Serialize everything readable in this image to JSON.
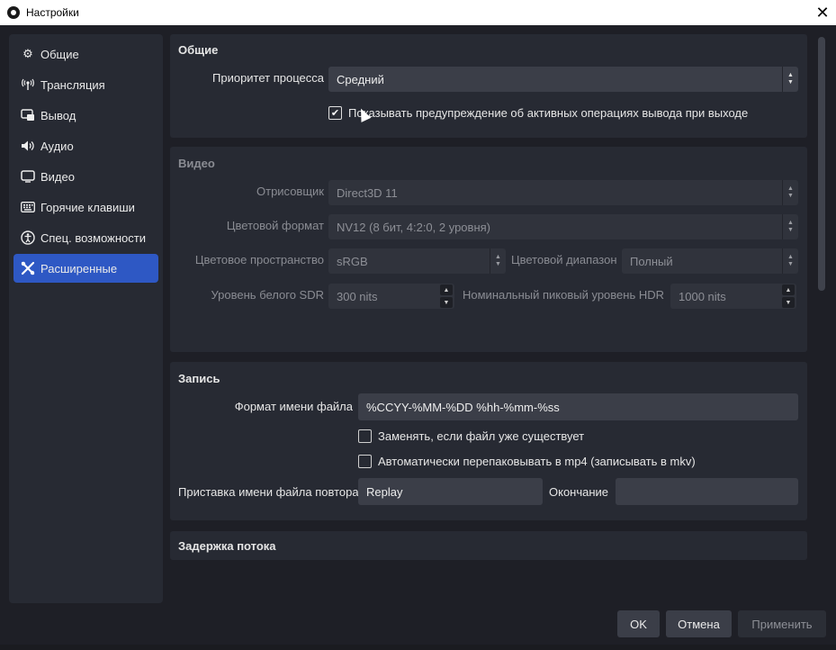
{
  "window": {
    "title": "Настройки",
    "close_glyph": "✕"
  },
  "sidebar": {
    "items": [
      {
        "label": "Общие",
        "icon": "gear-icon",
        "glyph": "⚙"
      },
      {
        "label": "Трансляция",
        "icon": "broadcast-icon",
        "glyph": "📡"
      },
      {
        "label": "Вывод",
        "icon": "output-icon",
        "glyph": "▭"
      },
      {
        "label": "Аудио",
        "icon": "speaker-icon",
        "glyph": "🔊"
      },
      {
        "label": "Видео",
        "icon": "monitor-icon",
        "glyph": "▢"
      },
      {
        "label": "Горячие клавиши",
        "icon": "keyboard-icon",
        "glyph": "⌨"
      },
      {
        "label": "Спец. возможности",
        "icon": "accessibility-icon",
        "glyph": "◉"
      },
      {
        "label": "Расширенные",
        "icon": "tools-icon",
        "glyph": "✖",
        "active": true
      }
    ]
  },
  "general": {
    "title": "Общие",
    "priority_label": "Приоритет процесса",
    "priority_value": "Средний",
    "warn_checkbox_label": "Показывать предупреждение об активных операциях вывода при выходе",
    "warn_checked": true
  },
  "video": {
    "title": "Видео",
    "renderer_label": "Отрисовщик",
    "renderer_value": "Direct3D 11",
    "color_format_label": "Цветовой формат",
    "color_format_value": "NV12 (8 бит, 4:2:0, 2 уровня)",
    "color_space_label": "Цветовое пространство",
    "color_space_value": "sRGB",
    "color_range_label": "Цветовой диапазон",
    "color_range_value": "Полный",
    "sdr_white_label": "Уровень белого SDR",
    "sdr_white_value": "300 nits",
    "hdr_peak_label": "Номинальный пиковый уровень HDR",
    "hdr_peak_value": "1000 nits"
  },
  "recording": {
    "title": "Запись",
    "filename_format_label": "Формат имени файла",
    "filename_format_value": "%CCYY-%MM-%DD %hh-%mm-%ss",
    "overwrite_label": "Заменять, если файл уже существует",
    "overwrite_checked": false,
    "remux_label": "Автоматически перепаковывать в mp4 (записывать в mkv)",
    "remux_checked": false,
    "replay_prefix_label": "Приставка имени файла повтора",
    "replay_prefix_value": "Replay",
    "suffix_label": "Окончание",
    "suffix_value": ""
  },
  "stream_delay": {
    "title": "Задержка потока"
  },
  "buttons": {
    "ok": "OK",
    "cancel": "Отмена",
    "apply": "Применить"
  },
  "colors": {
    "accent": "#2e58c4",
    "background": "#1e1f26",
    "panel": "#272a33"
  }
}
